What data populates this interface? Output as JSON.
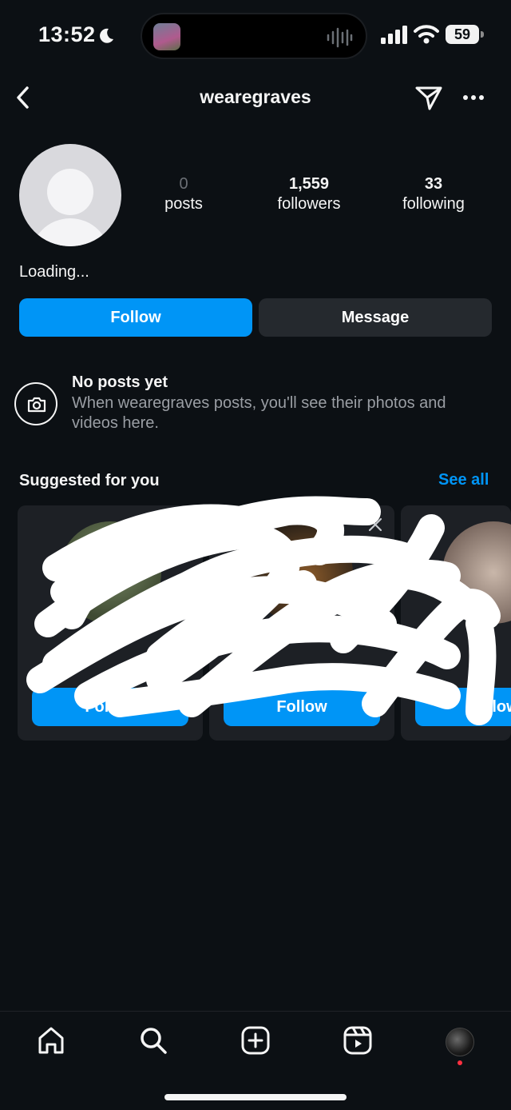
{
  "status_bar": {
    "time": "13:52",
    "battery": "59",
    "icons": [
      "moon-icon",
      "audio-wave-icon",
      "signal-icon",
      "wifi-icon",
      "battery-icon"
    ]
  },
  "header": {
    "username": "wearegraves",
    "icons": [
      "back-icon",
      "send-icon",
      "more-icon"
    ]
  },
  "profile": {
    "stats": [
      {
        "value": "0",
        "label": "posts"
      },
      {
        "value": "1,559",
        "label": "followers"
      },
      {
        "value": "33",
        "label": "following"
      }
    ],
    "bio": "Loading...",
    "follow_label": "Follow",
    "message_label": "Message"
  },
  "empty_state": {
    "title": "No posts yet",
    "description": "When wearegraves posts, you'll see their photos and videos here.",
    "icon": "camera-icon"
  },
  "suggested": {
    "title": "Suggested for you",
    "see_all": "See all",
    "cards": [
      {
        "follow_label": "Follow"
      },
      {
        "follow_label": "Follow"
      },
      {
        "follow_label": "Follow"
      }
    ]
  },
  "bottom_nav": {
    "items": [
      "home-icon",
      "search-icon",
      "create-icon",
      "reels-icon",
      "profile-avatar"
    ]
  },
  "colors": {
    "background": "#0c1014",
    "accent": "#0095f6",
    "secondary_button": "#25292e",
    "card": "#1d2025",
    "notification_dot": "#ff3040"
  }
}
